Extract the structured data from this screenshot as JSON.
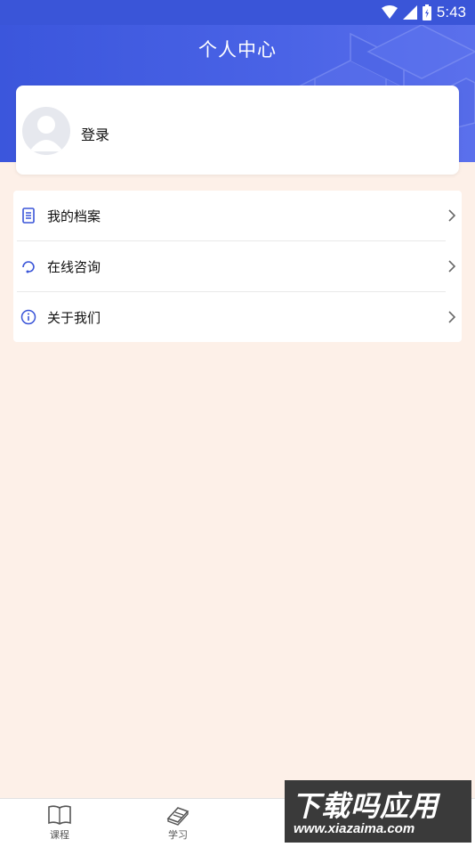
{
  "status_bar": {
    "time": "5:43",
    "icons": [
      "wifi-icon",
      "signal-icon",
      "battery-icon"
    ]
  },
  "header": {
    "title": "个人中心"
  },
  "profile": {
    "login_label": "登录"
  },
  "menu": {
    "items": [
      {
        "label": "我的档案",
        "icon": "document-icon"
      },
      {
        "label": "在线咨询",
        "icon": "headset-icon"
      },
      {
        "label": "关于我们",
        "icon": "info-icon"
      }
    ]
  },
  "bottom_nav": {
    "items": [
      {
        "label": "课程",
        "icon": "book-icon"
      },
      {
        "label": "学习",
        "icon": "study-book-icon"
      }
    ]
  },
  "watermark": {
    "title": "下载吗应用",
    "url": "www.xiazaima.com"
  },
  "colors": {
    "header_blue": "#3b56dc",
    "page_bg": "#fdf0e8",
    "icon_blue": "#3a55d8"
  }
}
